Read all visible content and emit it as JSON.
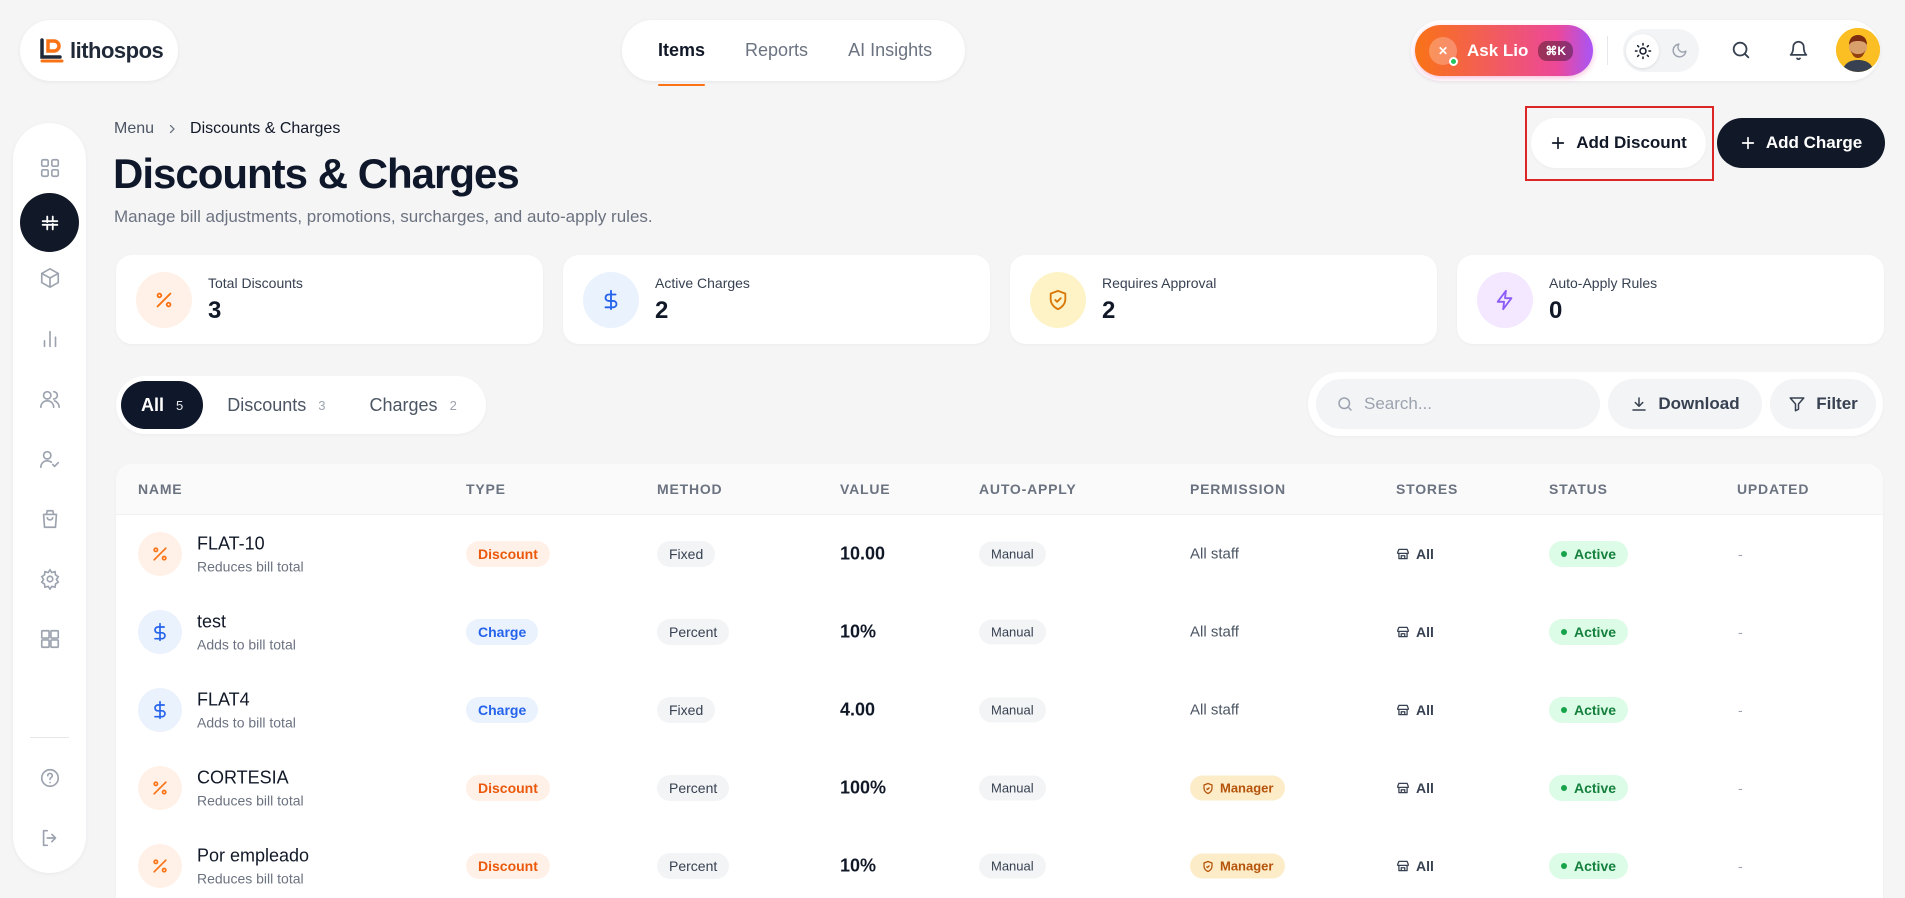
{
  "brand": {
    "name": "lithospos"
  },
  "topnav": {
    "items": [
      "Items",
      "Reports",
      "AI Insights"
    ],
    "active": "Items"
  },
  "header": {
    "ask_label": "Ask Lio",
    "ask_shortcut": "⌘K",
    "ask_avatar": "✕"
  },
  "breadcrumb": {
    "root": "Menu",
    "current": "Discounts & Charges"
  },
  "page": {
    "title": "Discounts & Charges",
    "subtitle": "Manage bill adjustments, promotions, surcharges, and auto-apply rules."
  },
  "actions": {
    "add_discount": "Add Discount",
    "add_charge": "Add Charge"
  },
  "stats": [
    {
      "label": "Total Discounts",
      "value": "3",
      "icon": "percent-icon",
      "color": "#f97316",
      "bg": "#fff1e7"
    },
    {
      "label": "Active Charges",
      "value": "2",
      "icon": "dollar-icon",
      "color": "#2563eb",
      "bg": "#eaf2fd"
    },
    {
      "label": "Requires Approval",
      "value": "2",
      "icon": "shield-check-icon",
      "color": "#d97706",
      "bg": "#fdf3c7"
    },
    {
      "label": "Auto-Apply Rules",
      "value": "0",
      "icon": "lightning-icon",
      "color": "#8b5cf6",
      "bg": "#f3e8ff"
    }
  ],
  "tabs": [
    {
      "label": "All",
      "count": "5"
    },
    {
      "label": "Discounts",
      "count": "3"
    },
    {
      "label": "Charges",
      "count": "2"
    }
  ],
  "toolbar": {
    "search_placeholder": "Search...",
    "download": "Download",
    "filter": "Filter"
  },
  "table": {
    "headers": [
      "NAME",
      "TYPE",
      "METHOD",
      "VALUE",
      "AUTO-APPLY",
      "PERMISSION",
      "STORES",
      "STATUS",
      "UPDATED"
    ],
    "rows": [
      {
        "name": "FLAT-10",
        "desc": "Reduces bill total",
        "type": "Discount",
        "method": "Fixed",
        "value": "10.00",
        "auto": "Manual",
        "permission": "All staff",
        "stores": "All",
        "status": "Active",
        "updated": "-"
      },
      {
        "name": "test",
        "desc": "Adds to bill total",
        "type": "Charge",
        "method": "Percent",
        "value": "10%",
        "auto": "Manual",
        "permission": "All staff",
        "stores": "All",
        "status": "Active",
        "updated": "-"
      },
      {
        "name": "FLAT4",
        "desc": "Adds to bill total",
        "type": "Charge",
        "method": "Fixed",
        "value": "4.00",
        "auto": "Manual",
        "permission": "All staff",
        "stores": "All",
        "status": "Active",
        "updated": "-"
      },
      {
        "name": "CORTESIA",
        "desc": "Reduces bill total",
        "type": "Discount",
        "method": "Percent",
        "value": "100%",
        "auto": "Manual",
        "permission": "Manager",
        "stores": "All",
        "status": "Active",
        "updated": "-"
      },
      {
        "name": "Por empleado",
        "desc": "Reduces bill total",
        "type": "Discount",
        "method": "Percent",
        "value": "10%",
        "auto": "Manual",
        "permission": "Manager",
        "stores": "All",
        "status": "Active",
        "updated": "-"
      }
    ]
  }
}
